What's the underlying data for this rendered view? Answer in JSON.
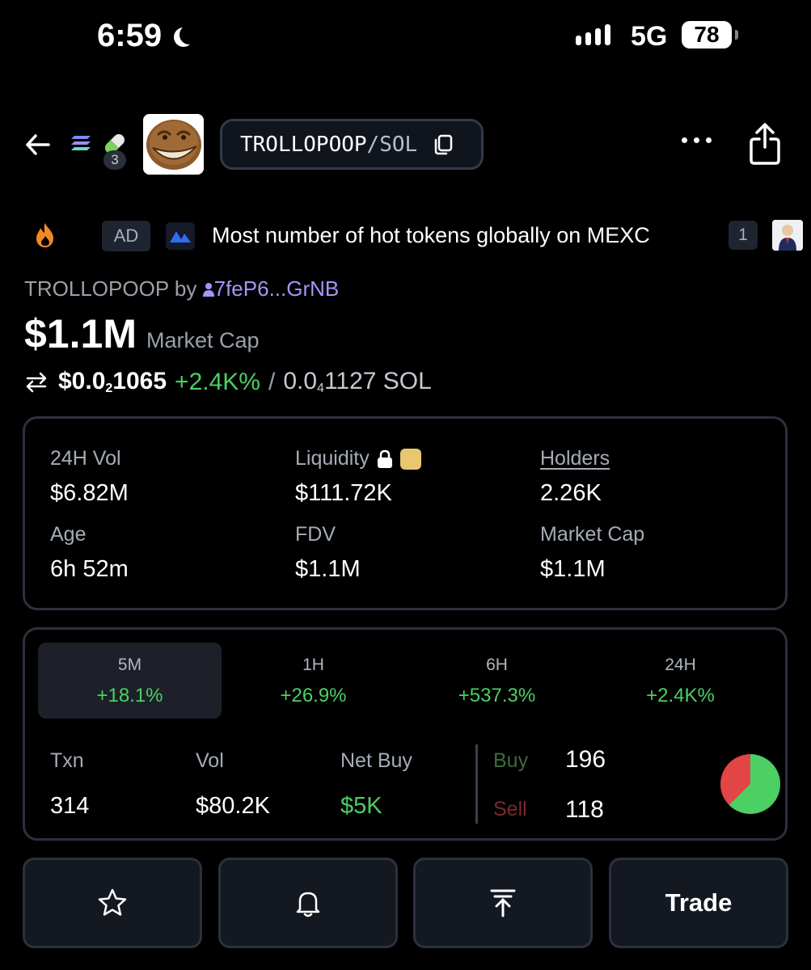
{
  "status_bar": {
    "time": "6:59",
    "network": "5G",
    "battery": "78"
  },
  "header": {
    "pill_count": "3",
    "pair_base": "TROLLOPOOP",
    "pair_sep": "/",
    "pair_quote": "SOL"
  },
  "ad": {
    "badge": "AD",
    "text": "Most number of hot tokens globally on MEXC",
    "count": "1"
  },
  "token": {
    "name": "TROLLOPOOP",
    "by": "by",
    "creator": "7feP6...GrNB",
    "market_cap": "$1.1M",
    "market_cap_label": "Market Cap",
    "price_usd_prefix": "$0.0",
    "price_usd_sub": "2",
    "price_usd_rest": "1065",
    "price_change": "+2.4K%",
    "price_sep": "/",
    "price_sol_prefix": "0.0",
    "price_sol_sub": "4",
    "price_sol_rest": "1127 SOL"
  },
  "stats": {
    "vol24_label": "24H Vol",
    "vol24": "$6.82M",
    "liquidity_label": "Liquidity",
    "liquidity": "$111.72K",
    "holders_label": "Holders",
    "holders": "2.26K",
    "age_label": "Age",
    "age": "6h 52m",
    "fdv_label": "FDV",
    "fdv": "$1.1M",
    "mcap_label": "Market Cap",
    "mcap": "$1.1M"
  },
  "timeframes": [
    {
      "label": "5M",
      "value": "+18.1%"
    },
    {
      "label": "1H",
      "value": "+26.9%"
    },
    {
      "label": "6H",
      "value": "+537.3%"
    },
    {
      "label": "24H",
      "value": "+2.4K%"
    }
  ],
  "txn": {
    "txn_label": "Txn",
    "txn": "314",
    "vol_label": "Vol",
    "vol": "$80.2K",
    "netbuy_label": "Net Buy",
    "netbuy": "$5K",
    "buy_label": "Buy",
    "buy": "196",
    "sell_label": "Sell",
    "sell": "118",
    "buy_fraction": 0.624,
    "buy_color": "#4ccf63",
    "sell_color": "#e24545"
  },
  "buttons": {
    "trade": "Trade"
  }
}
